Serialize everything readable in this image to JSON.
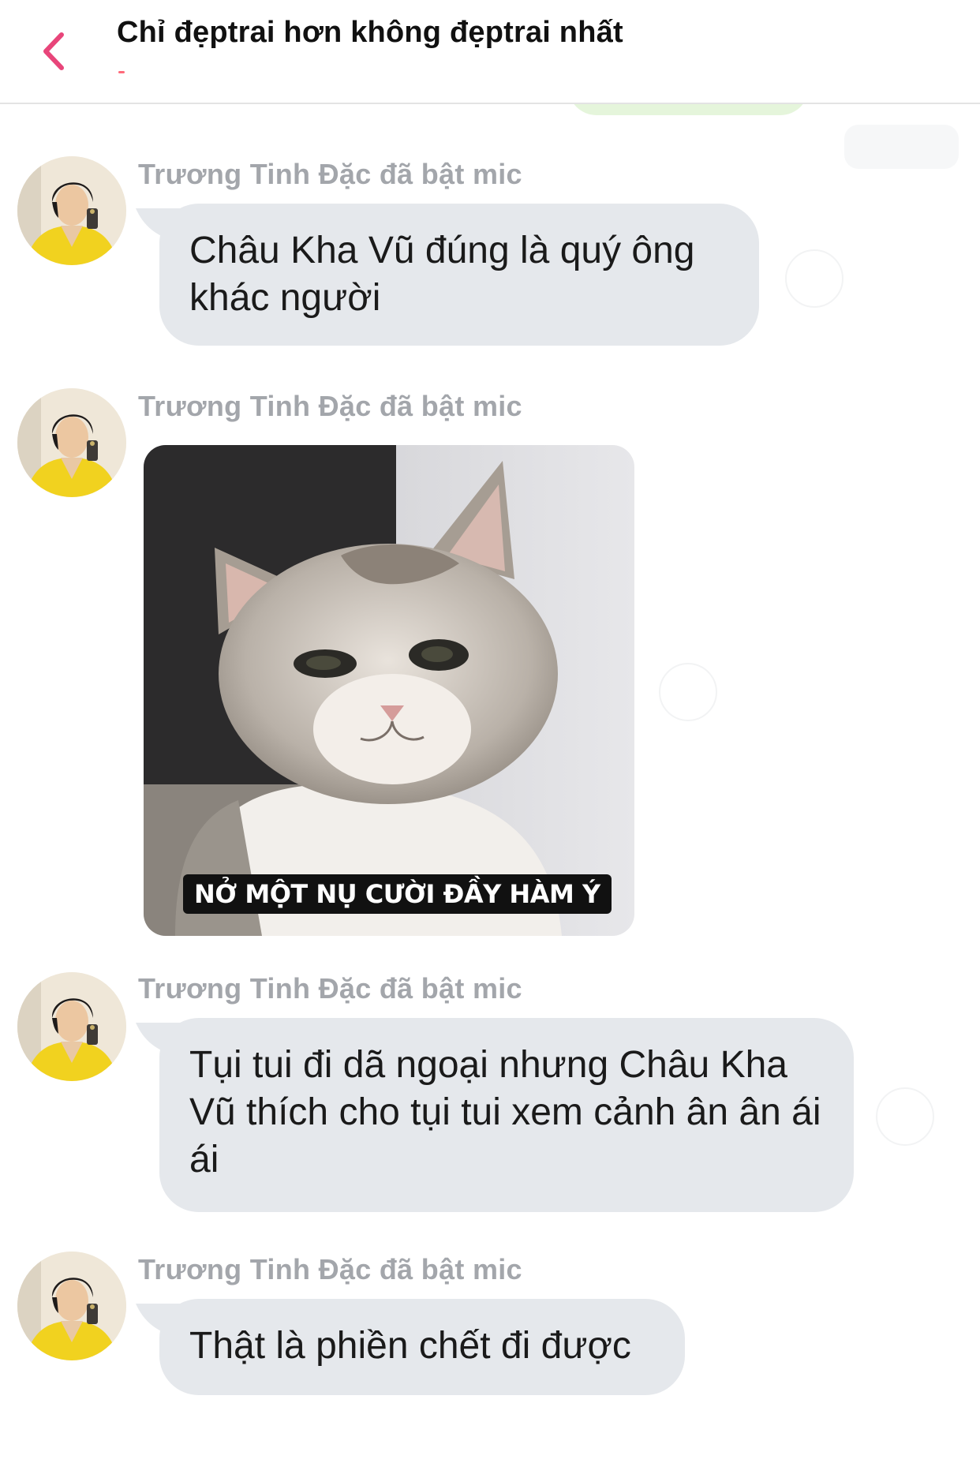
{
  "header": {
    "title": "Chỉ đẹptrai hơn không đẹptrai nhất",
    "back_icon": "chevron-left-icon",
    "accent_color": "#e8457a"
  },
  "messages": [
    {
      "sender": "Trương Tinh Đặc đã bật mic",
      "type": "text",
      "text": "Châu Kha Vũ đúng là quý ông khác người"
    },
    {
      "sender": "Trương Tinh Đặc đã bật mic",
      "type": "image",
      "image_caption": "NỞ MỘT NỤ CƯỜI ĐẦY HÀM Ý"
    },
    {
      "sender": "Trương Tinh Đặc đã bật mic",
      "type": "text",
      "text": "Tụi tui đi dã ngoại nhưng Châu Kha Vũ thích cho tụi tui xem cảnh ân ân ái ái"
    },
    {
      "sender": "Trương Tinh Đặc đã bật mic",
      "type": "text",
      "text": "Thật là phiền chết đi được"
    }
  ],
  "colors": {
    "bubble_bg": "#e5e8ec",
    "sender_text": "#a3a6ab"
  }
}
